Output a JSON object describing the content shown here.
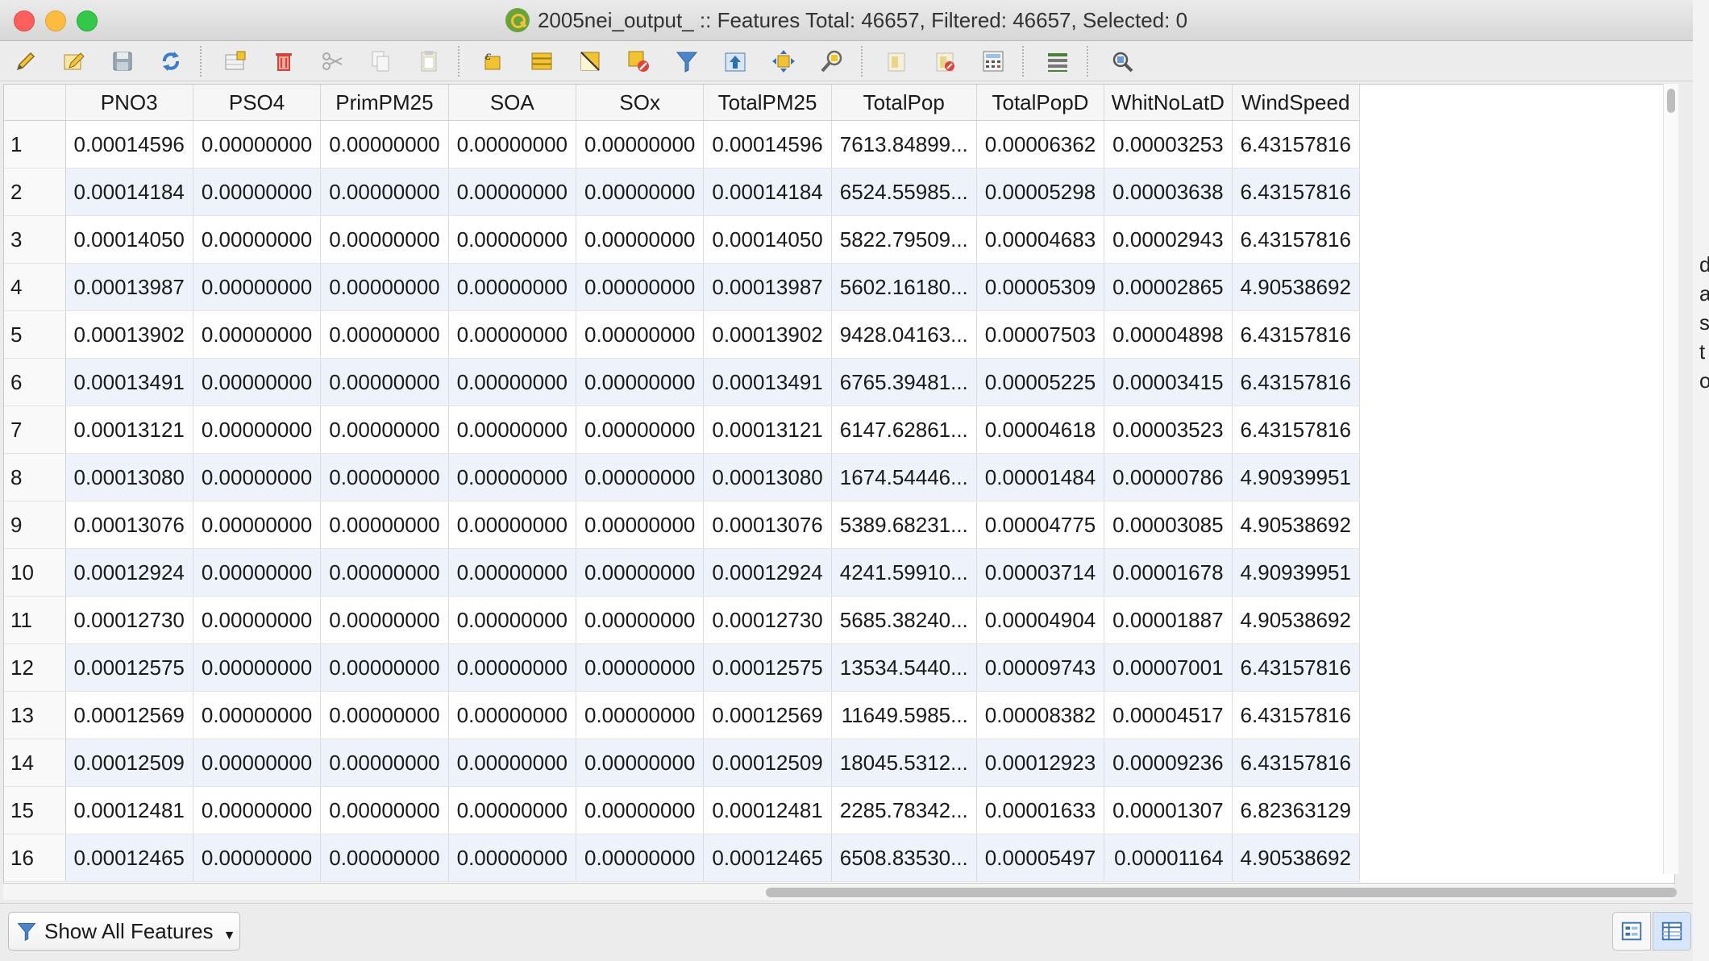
{
  "window": {
    "title": "2005nei_output_ :: Features Total: 46657, Filtered: 46657, Selected: 0"
  },
  "toolbar": {
    "buttons": [
      "toggle-editing-icon",
      "multi-edit-icon",
      "save-edits-icon",
      "reload-icon",
      "add-feature-icon",
      "delete-feature-icon",
      "cut-icon",
      "copy-icon",
      "paste-icon",
      "select-by-expression-icon",
      "select-all-icon",
      "invert-selection-icon",
      "deselect-all-icon",
      "filter-selection-icon",
      "move-selection-top-icon",
      "pan-to-selection-icon",
      "zoom-to-selection-icon",
      "new-field-icon",
      "delete-field-icon",
      "field-calculator-icon",
      "conditional-formatting-icon",
      "dock-table-icon"
    ]
  },
  "table": {
    "columns": [
      "PNO3",
      "PSO4",
      "PrimPM25",
      "SOA",
      "SOx",
      "TotalPM25",
      "TotalPop",
      "TotalPopD",
      "WhitNoLatD",
      "WindSpeed"
    ],
    "rows": [
      {
        "n": "1",
        "cells": [
          "0.00014596",
          "0.00000000",
          "0.00000000",
          "0.00000000",
          "0.00000000",
          "0.00014596",
          "7613.84899...",
          "0.00006362",
          "0.00003253",
          "6.43157816"
        ]
      },
      {
        "n": "2",
        "cells": [
          "0.00014184",
          "0.00000000",
          "0.00000000",
          "0.00000000",
          "0.00000000",
          "0.00014184",
          "6524.55985...",
          "0.00005298",
          "0.00003638",
          "6.43157816"
        ]
      },
      {
        "n": "3",
        "cells": [
          "0.00014050",
          "0.00000000",
          "0.00000000",
          "0.00000000",
          "0.00000000",
          "0.00014050",
          "5822.79509...",
          "0.00004683",
          "0.00002943",
          "6.43157816"
        ]
      },
      {
        "n": "4",
        "cells": [
          "0.00013987",
          "0.00000000",
          "0.00000000",
          "0.00000000",
          "0.00000000",
          "0.00013987",
          "5602.16180...",
          "0.00005309",
          "0.00002865",
          "4.90538692"
        ]
      },
      {
        "n": "5",
        "cells": [
          "0.00013902",
          "0.00000000",
          "0.00000000",
          "0.00000000",
          "0.00000000",
          "0.00013902",
          "9428.04163...",
          "0.00007503",
          "0.00004898",
          "6.43157816"
        ]
      },
      {
        "n": "6",
        "cells": [
          "0.00013491",
          "0.00000000",
          "0.00000000",
          "0.00000000",
          "0.00000000",
          "0.00013491",
          "6765.39481...",
          "0.00005225",
          "0.00003415",
          "6.43157816"
        ]
      },
      {
        "n": "7",
        "cells": [
          "0.00013121",
          "0.00000000",
          "0.00000000",
          "0.00000000",
          "0.00000000",
          "0.00013121",
          "6147.62861...",
          "0.00004618",
          "0.00003523",
          "6.43157816"
        ]
      },
      {
        "n": "8",
        "cells": [
          "0.00013080",
          "0.00000000",
          "0.00000000",
          "0.00000000",
          "0.00000000",
          "0.00013080",
          "1674.54446...",
          "0.00001484",
          "0.00000786",
          "4.90939951"
        ]
      },
      {
        "n": "9",
        "cells": [
          "0.00013076",
          "0.00000000",
          "0.00000000",
          "0.00000000",
          "0.00000000",
          "0.00013076",
          "5389.68231...",
          "0.00004775",
          "0.00003085",
          "4.90538692"
        ]
      },
      {
        "n": "10",
        "cells": [
          "0.00012924",
          "0.00000000",
          "0.00000000",
          "0.00000000",
          "0.00000000",
          "0.00012924",
          "4241.59910...",
          "0.00003714",
          "0.00001678",
          "4.90939951"
        ]
      },
      {
        "n": "11",
        "cells": [
          "0.00012730",
          "0.00000000",
          "0.00000000",
          "0.00000000",
          "0.00000000",
          "0.00012730",
          "5685.38240...",
          "0.00004904",
          "0.00001887",
          "4.90538692"
        ]
      },
      {
        "n": "12",
        "cells": [
          "0.00012575",
          "0.00000000",
          "0.00000000",
          "0.00000000",
          "0.00000000",
          "0.00012575",
          "13534.5440...",
          "0.00009743",
          "0.00007001",
          "6.43157816"
        ]
      },
      {
        "n": "13",
        "cells": [
          "0.00012569",
          "0.00000000",
          "0.00000000",
          "0.00000000",
          "0.00000000",
          "0.00012569",
          "11649.5985...",
          "0.00008382",
          "0.00004517",
          "6.43157816"
        ]
      },
      {
        "n": "14",
        "cells": [
          "0.00012509",
          "0.00000000",
          "0.00000000",
          "0.00000000",
          "0.00000000",
          "0.00012509",
          "18045.5312...",
          "0.00012923",
          "0.00009236",
          "6.43157816"
        ]
      },
      {
        "n": "15",
        "cells": [
          "0.00012481",
          "0.00000000",
          "0.00000000",
          "0.00000000",
          "0.00000000",
          "0.00012481",
          "2285.78342...",
          "0.00001633",
          "0.00001307",
          "6.82363129"
        ]
      },
      {
        "n": "16",
        "cells": [
          "0.00012465",
          "0.00000000",
          "0.00000000",
          "0.00000000",
          "0.00000000",
          "0.00012465",
          "6508.83530...",
          "0.00005497",
          "0.00001164",
          "4.90538692"
        ]
      }
    ]
  },
  "bottombar": {
    "filter_label": "Show All Features"
  },
  "background_window": {
    "letters": [
      "d",
      "a",
      "s",
      "t",
      "o"
    ]
  }
}
